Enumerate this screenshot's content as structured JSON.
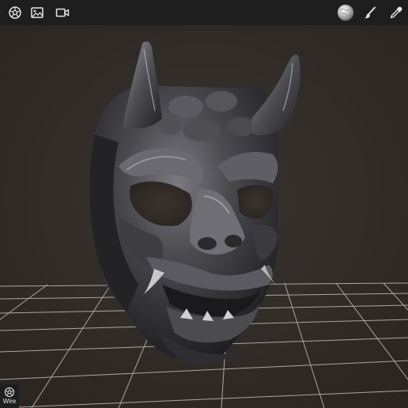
{
  "toolbar": {
    "left_icons": [
      "render-settings-icon",
      "image-icon",
      "video-camera-icon"
    ],
    "right_icons": [
      "matcap-sphere-icon",
      "brush-icon",
      "color-picker-icon"
    ]
  },
  "viewport": {
    "background_color": "#2f2a26",
    "grid_color": "#bfbfbf",
    "model_color": "#4a4a4e"
  },
  "wire_toggle": {
    "label": "Wire",
    "icon": "wireframe-icon"
  }
}
